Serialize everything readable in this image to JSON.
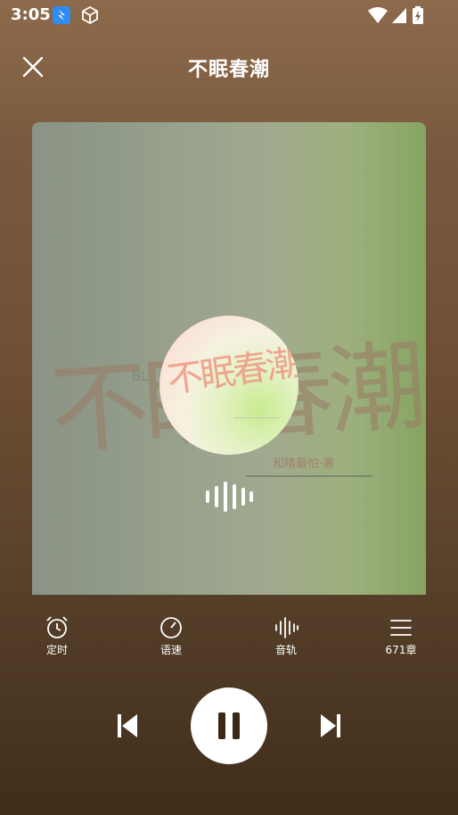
{
  "status_bar": {
    "time": "3:05"
  },
  "header": {
    "title": "不眠春潮"
  },
  "cover": {
    "big_title": "不眠春潮",
    "subtitle": "BL",
    "author": "和晴最怕·著"
  },
  "controls": [
    {
      "label": "定时",
      "icon": "alarm-clock-icon"
    },
    {
      "label": "语速",
      "icon": "speedometer-icon"
    },
    {
      "label": "音轨",
      "icon": "audio-track-icon"
    },
    {
      "label": "671章",
      "icon": "menu-list-icon"
    }
  ],
  "player": {
    "state": "playing",
    "icons": [
      "previous-icon",
      "pause-icon",
      "next-icon"
    ]
  },
  "colors": {
    "background_top": "#8e6a4c",
    "background_bottom": "#3f2d1a",
    "accent": "#ffffff"
  }
}
